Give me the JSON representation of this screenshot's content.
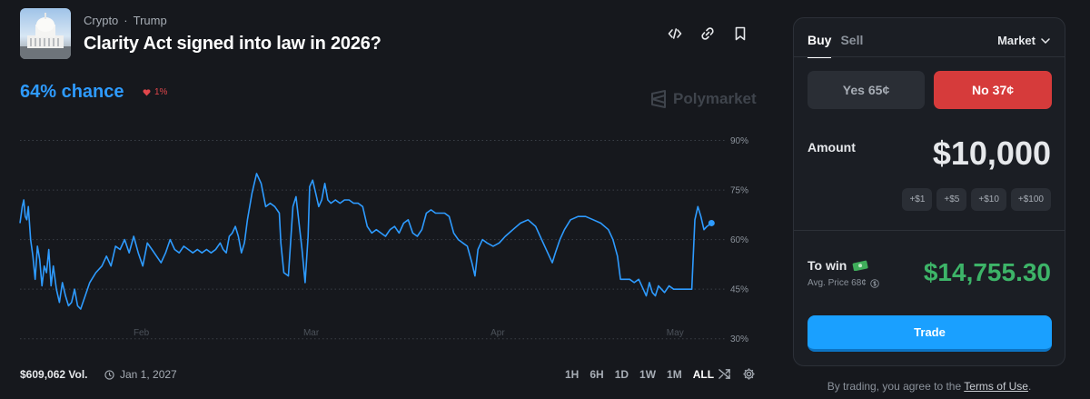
{
  "header": {
    "category_1": "Crypto",
    "separator": "·",
    "category_2": "Trump",
    "title": "Clarity Act signed into law in 2026?"
  },
  "icons": {
    "embed": "code-icon",
    "link": "link-icon",
    "bookmark": "bookmark-icon",
    "delta": "heart-down-icon",
    "clock": "clock-icon",
    "swap": "shuffle-icon",
    "settings": "gear-icon",
    "chevron": "chevron-down-icon",
    "info": "dollar-circle-icon",
    "cash": "money-icon"
  },
  "market": {
    "chance": "64% chance",
    "delta": "1%",
    "watermark": "Polymarket",
    "volume": "$609,062 Vol.",
    "end_date": "Jan 1, 2027",
    "ranges": [
      "1H",
      "6H",
      "1D",
      "1W",
      "1M",
      "ALL"
    ],
    "active_range": "ALL"
  },
  "colors": {
    "accent": "#2e9bff",
    "no": "#d63b3b",
    "win": "#3db468",
    "trade": "#1aa0ff"
  },
  "chart_data": {
    "type": "line",
    "series": [
      {
        "values": [
          [
            0,
            65
          ],
          [
            0.15,
            70
          ],
          [
            0.25,
            72
          ],
          [
            0.35,
            67
          ],
          [
            0.45,
            66
          ],
          [
            0.55,
            70
          ],
          [
            0.7,
            60
          ],
          [
            0.85,
            55
          ],
          [
            1.0,
            48
          ],
          [
            1.15,
            58
          ],
          [
            1.3,
            54
          ],
          [
            1.45,
            46
          ],
          [
            1.6,
            52
          ],
          [
            1.75,
            50
          ],
          [
            1.9,
            57
          ],
          [
            2.05,
            46
          ],
          [
            2.2,
            52
          ],
          [
            2.4,
            45
          ],
          [
            2.6,
            41
          ],
          [
            2.8,
            47
          ],
          [
            3.0,
            43
          ],
          [
            3.2,
            40
          ],
          [
            3.4,
            41
          ],
          [
            3.6,
            45
          ],
          [
            3.8,
            40
          ],
          [
            4.0,
            39
          ],
          [
            4.3,
            43
          ],
          [
            4.6,
            47
          ],
          [
            5.0,
            50
          ],
          [
            5.4,
            52
          ],
          [
            5.7,
            55
          ],
          [
            6.0,
            52
          ],
          [
            6.3,
            58
          ],
          [
            6.6,
            57
          ],
          [
            6.9,
            60
          ],
          [
            7.2,
            56
          ],
          [
            7.5,
            61
          ],
          [
            7.8,
            56
          ],
          [
            8.1,
            52
          ],
          [
            8.4,
            59
          ],
          [
            8.7,
            57
          ],
          [
            9.0,
            55
          ],
          [
            9.3,
            53
          ],
          [
            9.6,
            56
          ],
          [
            9.9,
            60
          ],
          [
            10.2,
            57
          ],
          [
            10.5,
            56
          ],
          [
            10.8,
            58
          ],
          [
            11.1,
            57
          ],
          [
            11.4,
            56
          ],
          [
            11.7,
            57
          ],
          [
            12.0,
            56
          ],
          [
            12.3,
            57
          ],
          [
            12.6,
            56
          ],
          [
            12.9,
            57
          ],
          [
            13.2,
            59
          ],
          [
            13.4,
            57
          ],
          [
            13.6,
            56
          ],
          [
            13.8,
            61
          ],
          [
            14.0,
            62
          ],
          [
            14.2,
            64
          ],
          [
            14.4,
            61
          ],
          [
            14.6,
            56
          ],
          [
            14.8,
            59
          ],
          [
            15.0,
            66
          ],
          [
            15.3,
            74
          ],
          [
            15.6,
            80
          ],
          [
            15.9,
            77
          ],
          [
            16.2,
            70
          ],
          [
            16.5,
            71
          ],
          [
            16.8,
            70
          ],
          [
            17.1,
            68
          ],
          [
            17.2,
            59
          ],
          [
            17.4,
            50
          ],
          [
            17.7,
            49
          ],
          [
            18.0,
            70
          ],
          [
            18.2,
            73
          ],
          [
            18.4,
            65
          ],
          [
            18.6,
            57
          ],
          [
            18.8,
            47
          ],
          [
            19.0,
            61
          ],
          [
            19.1,
            76
          ],
          [
            19.3,
            78
          ],
          [
            19.5,
            74
          ],
          [
            19.7,
            70
          ],
          [
            19.9,
            72
          ],
          [
            20.1,
            77
          ],
          [
            20.3,
            72
          ],
          [
            20.5,
            71
          ],
          [
            20.8,
            72
          ],
          [
            21.1,
            71
          ],
          [
            21.4,
            72
          ],
          [
            21.7,
            72
          ],
          [
            22.0,
            71
          ],
          [
            22.3,
            71
          ],
          [
            22.6,
            70
          ],
          [
            22.9,
            64
          ],
          [
            23.2,
            62
          ],
          [
            23.5,
            63
          ],
          [
            23.8,
            62
          ],
          [
            24.1,
            61
          ],
          [
            24.4,
            63
          ],
          [
            24.7,
            64
          ],
          [
            25.0,
            62
          ],
          [
            25.3,
            65
          ],
          [
            25.6,
            66
          ],
          [
            25.9,
            62
          ],
          [
            26.2,
            61
          ],
          [
            26.5,
            63
          ],
          [
            26.8,
            68
          ],
          [
            27.1,
            69
          ],
          [
            27.4,
            68
          ],
          [
            27.7,
            68
          ],
          [
            28.0,
            68
          ],
          [
            28.3,
            67
          ],
          [
            28.6,
            62
          ],
          [
            28.9,
            60
          ],
          [
            29.2,
            59
          ],
          [
            29.5,
            58
          ],
          [
            29.8,
            53
          ],
          [
            30.0,
            49
          ],
          [
            30.2,
            57
          ],
          [
            30.5,
            60
          ],
          [
            30.8,
            59
          ],
          [
            31.2,
            58
          ],
          [
            31.6,
            59
          ],
          [
            32.0,
            61
          ],
          [
            32.5,
            63
          ],
          [
            33.0,
            65
          ],
          [
            33.5,
            66
          ],
          [
            34.0,
            64
          ],
          [
            34.4,
            60
          ],
          [
            34.8,
            56
          ],
          [
            35.1,
            53
          ],
          [
            35.3,
            56
          ],
          [
            35.6,
            60
          ],
          [
            35.9,
            63
          ],
          [
            36.3,
            66
          ],
          [
            36.8,
            67
          ],
          [
            37.3,
            67
          ],
          [
            37.8,
            66
          ],
          [
            38.3,
            65
          ],
          [
            38.8,
            63
          ],
          [
            39.1,
            60
          ],
          [
            39.4,
            55
          ],
          [
            39.6,
            48
          ],
          [
            39.9,
            48
          ],
          [
            40.2,
            48
          ],
          [
            40.5,
            47
          ],
          [
            40.8,
            48
          ],
          [
            41.1,
            45
          ],
          [
            41.3,
            43
          ],
          [
            41.5,
            47
          ],
          [
            41.7,
            44
          ],
          [
            41.9,
            43
          ],
          [
            42.1,
            46
          ],
          [
            42.3,
            45
          ],
          [
            42.5,
            44
          ],
          [
            42.8,
            46
          ],
          [
            43.1,
            45
          ],
          [
            43.4,
            45
          ],
          [
            43.7,
            45
          ],
          [
            44.0,
            45
          ],
          [
            44.3,
            45
          ],
          [
            44.5,
            66
          ],
          [
            44.7,
            70
          ],
          [
            44.9,
            67
          ],
          [
            45.1,
            63
          ],
          [
            45.3,
            64
          ],
          [
            45.6,
            65
          ]
        ]
      }
    ],
    "x_range": [
      0,
      46
    ],
    "ylim": [
      28,
      94
    ],
    "yticks": [
      "90%",
      "75%",
      "60%",
      "45%",
      "30%"
    ],
    "ytick_values": [
      90,
      75,
      60,
      45,
      30
    ],
    "xticks": [
      "Feb",
      "Mar",
      "Apr",
      "May"
    ],
    "xtick_values": [
      8,
      19.2,
      31.5,
      43.2
    ],
    "grid": true
  },
  "panel": {
    "tab_buy": "Buy",
    "tab_sell": "Sell",
    "order_type": "Market",
    "yes_label": "Yes",
    "yes_price": "65¢",
    "no_label": "No",
    "no_price": "37¢",
    "amount_label": "Amount",
    "amount_value": "$10,000",
    "quick_amounts": [
      "+$1",
      "+$5",
      "+$10",
      "+$100"
    ],
    "to_win_label": "To win",
    "avg_price": "Avg. Price 68¢",
    "to_win_value": "$14,755.30",
    "trade_label": "Trade"
  },
  "footer": {
    "terms_prefix": "By trading, you agree to the",
    "terms_link": "Terms of Use",
    "terms_suffix": "."
  }
}
